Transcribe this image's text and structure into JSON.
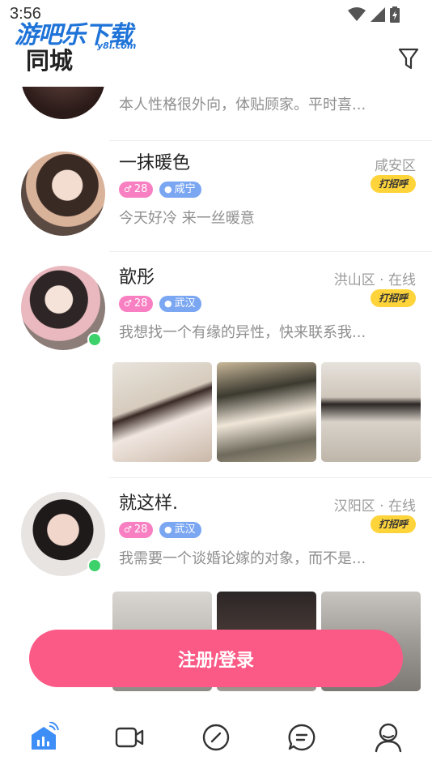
{
  "status_bar": {
    "time": "3:56"
  },
  "watermark": {
    "text": "游吧乐下载",
    "sub": "y8l.com"
  },
  "header": {
    "title": "同城"
  },
  "users": [
    {
      "bio": "本人性格很外向，体贴顾家。平时喜..."
    },
    {
      "name": "一抹暖色",
      "location": "咸安区",
      "greet_label": "打招呼",
      "age": "28",
      "city": "咸宁",
      "bio": "今天好冷 来一丝暖意"
    },
    {
      "name": "歆彤",
      "location": "洪山区 · 在线",
      "greet_label": "打招呼",
      "age": "28",
      "city": "武汉",
      "bio": "我想找一个有缘的异性，快来联系我..."
    },
    {
      "name": "就这样.",
      "location": "汉阳区 · 在线",
      "greet_label": "打招呼",
      "age": "28",
      "city": "武汉",
      "bio": "我需要一个谈婚论嫁的对象，而不是..."
    }
  ],
  "cta": {
    "label": "注册/登录"
  },
  "tabs": [
    {
      "icon": "home-signal-icon",
      "active": true
    },
    {
      "icon": "video-icon"
    },
    {
      "icon": "compass-icon"
    },
    {
      "icon": "message-icon"
    },
    {
      "icon": "profile-icon"
    }
  ],
  "colors": {
    "accent": "#fc5a86",
    "greet": "#ffd43b",
    "age_badge": "#f77fc2",
    "city_badge": "#7aa6f2",
    "online": "#3cd16a",
    "tab_active": "#3d8ef7"
  }
}
